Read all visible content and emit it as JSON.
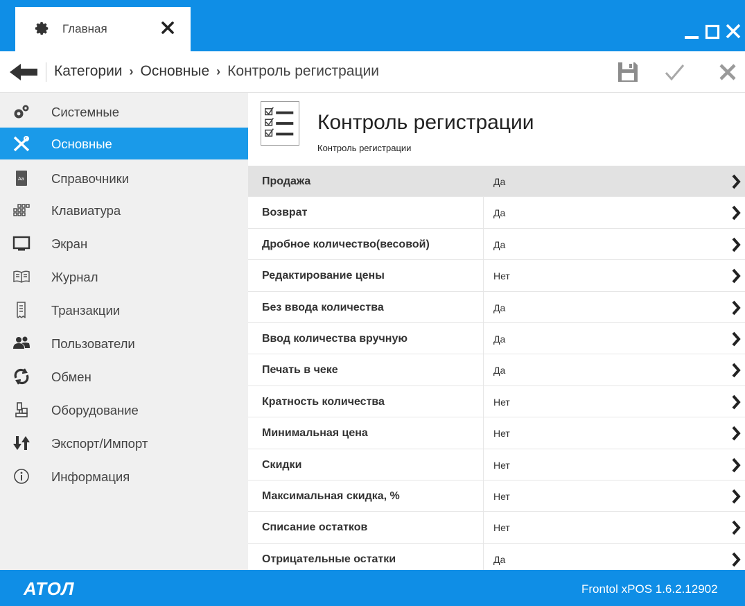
{
  "tab": {
    "label": "Главная"
  },
  "breadcrumb": {
    "items": [
      "Категории",
      "Основные",
      "Контроль регистрации"
    ],
    "separator": "›"
  },
  "sidebar": {
    "items": [
      {
        "label": "Системные",
        "icon": "settings-gears-icon"
      },
      {
        "label": "Основные",
        "icon": "tools-icon",
        "active": true
      },
      {
        "label": "Справочники",
        "icon": "book-icon"
      },
      {
        "label": "Клавиатура",
        "icon": "keyboard-icon"
      },
      {
        "label": "Экран",
        "icon": "monitor-icon"
      },
      {
        "label": "Журнал",
        "icon": "journal-icon"
      },
      {
        "label": "Транзакции",
        "icon": "receipt-icon"
      },
      {
        "label": "Пользователи",
        "icon": "users-icon"
      },
      {
        "label": "Обмен",
        "icon": "sync-icon"
      },
      {
        "label": "Оборудование",
        "icon": "equipment-icon"
      },
      {
        "label": "Экспорт/Импорт",
        "icon": "export-import-icon"
      },
      {
        "label": "Информация",
        "icon": "info-icon"
      }
    ]
  },
  "main": {
    "title": "Контроль регистрации",
    "subtitle": "Контроль регистрации",
    "rows": [
      {
        "key": "Продажа",
        "value": "Да",
        "selected": true
      },
      {
        "key": "Возврат",
        "value": "Да"
      },
      {
        "key": "Дробное количество(весовой)",
        "value": "Да"
      },
      {
        "key": "Редактирование цены",
        "value": "Нет"
      },
      {
        "key": "Без ввода количества",
        "value": "Да"
      },
      {
        "key": "Ввод количества вручную",
        "value": "Да"
      },
      {
        "key": "Печать в чеке",
        "value": "Да"
      },
      {
        "key": "Кратность количества",
        "value": "Нет"
      },
      {
        "key": "Минимальная цена",
        "value": "Нет"
      },
      {
        "key": "Скидки",
        "value": "Нет"
      },
      {
        "key": "Максимальная скидка, %",
        "value": "Нет"
      },
      {
        "key": "Списание остатков",
        "value": "Нет"
      },
      {
        "key": "Отрицательные остатки",
        "value": "Да"
      }
    ]
  },
  "footer": {
    "logo": "АТОЛ",
    "version": "Frontol xPOS 1.6.2.12902"
  },
  "colors": {
    "accent": "#0f8ee6",
    "active_item": "#1a9ae9",
    "sidebar_bg": "#f0f0f0",
    "selected_row": "#e2e2e2"
  }
}
